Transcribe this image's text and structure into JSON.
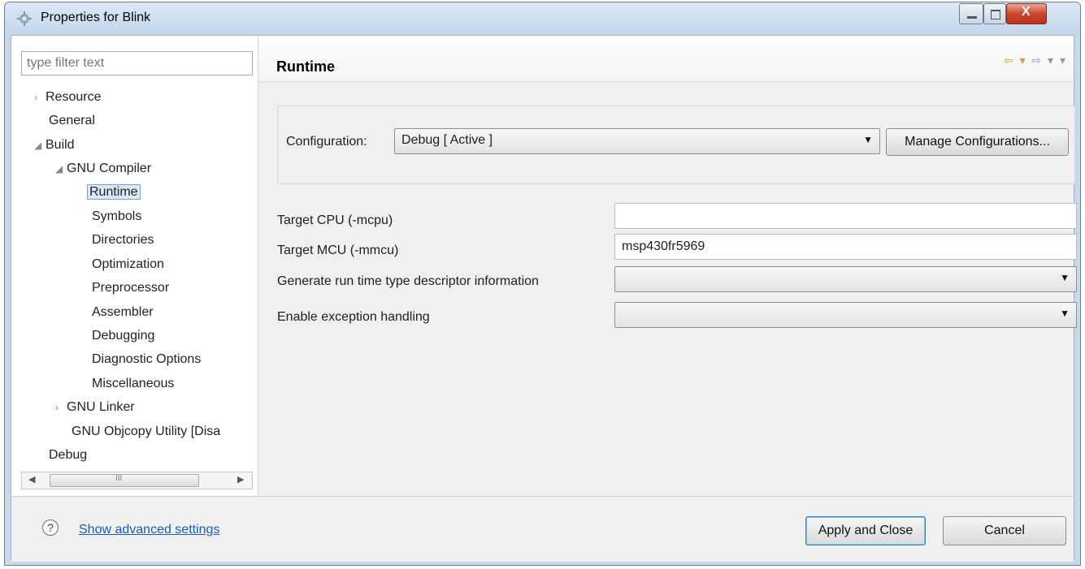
{
  "window": {
    "title": "Properties for Blink",
    "controls": {
      "minimize_icon": "minimize-icon",
      "maximize_icon": "maximize-icon",
      "close_icon": "close-icon"
    }
  },
  "sidebar": {
    "filter_placeholder": "type filter text",
    "items": [
      {
        "label": "Resource",
        "twisty": "›"
      },
      {
        "label": "General",
        "twisty": ""
      },
      {
        "label": "Build",
        "twisty": "◢"
      },
      {
        "label": "GNU Compiler",
        "twisty": "◢"
      },
      {
        "label": "Runtime",
        "twisty": ""
      },
      {
        "label": "Symbols",
        "twisty": ""
      },
      {
        "label": "Directories",
        "twisty": ""
      },
      {
        "label": "Optimization",
        "twisty": ""
      },
      {
        "label": "Preprocessor",
        "twisty": ""
      },
      {
        "label": "Assembler",
        "twisty": ""
      },
      {
        "label": "Debugging",
        "twisty": ""
      },
      {
        "label": "Diagnostic Options",
        "twisty": ""
      },
      {
        "label": "Miscellaneous",
        "twisty": ""
      },
      {
        "label": "GNU Linker",
        "twisty": "›"
      },
      {
        "label": "GNU Objcopy Utility  [Disa",
        "twisty": ""
      },
      {
        "label": "Debug",
        "twisty": ""
      }
    ],
    "scroll_grip": "III"
  },
  "main": {
    "title": "Runtime",
    "nav": {
      "back": "⇦ ▾",
      "forward": "⇨ ▾ ▾"
    },
    "configuration": {
      "label": "Configuration:",
      "value": "Debug  [ Active ]",
      "manage_button": "Manage Configurations..."
    },
    "fields": [
      {
        "label": "Target CPU (-mcpu)",
        "value": ""
      },
      {
        "label": "Target MCU (-mmcu)",
        "value": "msp430fr5969"
      },
      {
        "label": "Generate run time type descriptor information",
        "value": ""
      },
      {
        "label": "Enable exception handling",
        "value": ""
      }
    ]
  },
  "footer": {
    "help_icon": "?",
    "advanced_link": "Show advanced settings",
    "apply_button": "Apply and Close",
    "cancel_button": "Cancel"
  },
  "colors": {
    "link": "#1a5fb4",
    "selection": "#dbe8f8",
    "titlebar": "#c4d7ec"
  }
}
